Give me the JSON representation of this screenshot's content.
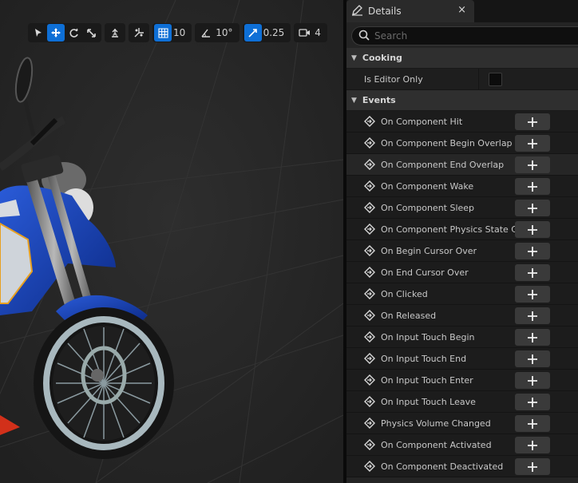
{
  "viewport": {
    "toolbar": {
      "grid_snap_value": "10",
      "rotation_snap_value": "10°",
      "scale_snap_value": "0.25",
      "camera_speed_value": "4"
    }
  },
  "details": {
    "tab_title": "Details",
    "close_glyph": "×",
    "search_placeholder": "Search",
    "sections": {
      "cooking": {
        "title": "Cooking",
        "props": [
          {
            "label": "Is Editor Only",
            "checked": false
          }
        ]
      },
      "events": {
        "title": "Events",
        "items": [
          "On Component Hit",
          "On Component Begin Overlap",
          "On Component End Overlap",
          "On Component Wake",
          "On Component Sleep",
          "On Component Physics State Change",
          "On Begin Cursor Over",
          "On End Cursor Over",
          "On Clicked",
          "On Released",
          "On Input Touch Begin",
          "On Input Touch End",
          "On Input Touch Enter",
          "On Input Touch Leave",
          "Physics Volume Changed",
          "On Component Activated",
          "On Component Deactivated"
        ]
      }
    }
  }
}
